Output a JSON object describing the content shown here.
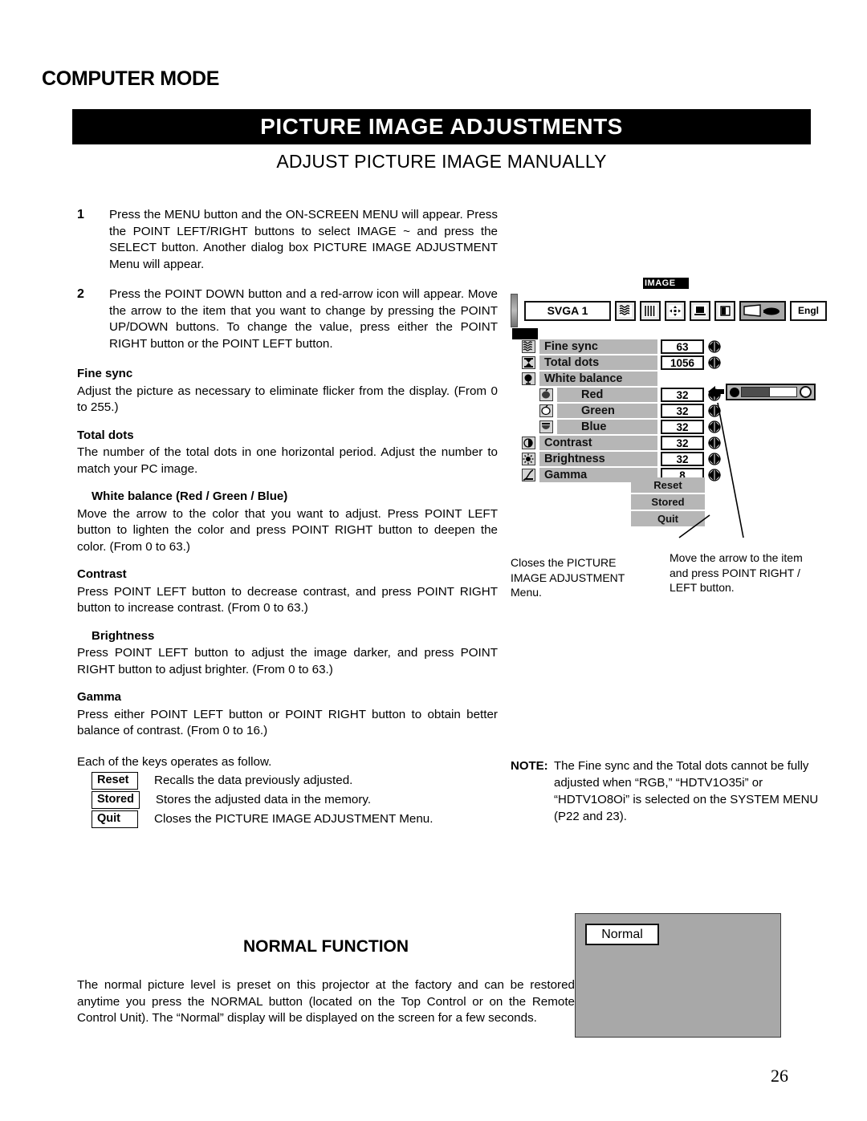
{
  "page": {
    "title": "COMPUTER MODE",
    "banner": "PICTURE IMAGE ADJUSTMENTS",
    "subbanner": "ADJUST PICTURE IMAGE MANUALLY",
    "number": "26"
  },
  "steps": [
    {
      "num": "1",
      "text": "Press the MENU button and the ON-SCREEN MENU will appear. Press the POINT LEFT/RIGHT buttons to select IMAGE ~ and press the SELECT button. Another dialog box PICTURE IMAGE ADJUSTMENT Menu will appear."
    },
    {
      "num": "2",
      "text": "Press the POINT DOWN button and a red-arrow icon will appear. Move the arrow to the item that you want to change by pressing the POINT UP/DOWN buttons. To change the value, press either the POINT RIGHT button or the POINT LEFT button."
    }
  ],
  "sections": [
    {
      "heading": "Fine sync",
      "body": "Adjust the picture as necessary to eliminate flicker from the display. (From 0 to 255.)"
    },
    {
      "heading": "Total dots",
      "body": "The number of the total dots in one horizontal period. Adjust the number to match your PC image."
    },
    {
      "heading": "White balance (Red / Green / Blue)",
      "body": "Move the arrow to the color that you want to adjust. Press POINT LEFT button to lighten the color and press POINT RIGHT button to deepen the color. (From 0 to 63.)"
    },
    {
      "heading": "Contrast",
      "body": "Press POINT LEFT button to decrease contrast, and press POINT RIGHT button to increase contrast. (From 0 to 63.)"
    },
    {
      "heading": "Brightness",
      "body": "Press POINT LEFT button to adjust the image darker, and press POINT RIGHT button to adjust brighter. (From 0 to 63.)"
    },
    {
      "heading": "Gamma",
      "body": "Press either POINT LEFT button or POINT RIGHT button to obtain better balance of contrast. (From 0 to 16.)"
    }
  ],
  "keys": {
    "intro": "Each of the keys operates as follow.",
    "rows": [
      {
        "key": "Reset",
        "desc": "Recalls the data previously adjusted."
      },
      {
        "key": "Stored",
        "desc": "Stores the adjusted data in the memory."
      },
      {
        "key": "Quit",
        "desc": "Closes the PICTURE IMAGE ADJUSTMENT Menu."
      }
    ]
  },
  "osd": {
    "source": "SVGA 1",
    "menu_tab": "IMAGE",
    "language": "Engl",
    "toolbar_icons": [
      "fine-sync-icon",
      "total-dots-icon",
      "position-icon",
      "screen-icon",
      "keystone-icon",
      "image-icon",
      "language-icon"
    ],
    "rows": [
      {
        "icon": "fine-sync-icon",
        "label": "Fine sync",
        "value": "63",
        "sub": false,
        "has_value": true
      },
      {
        "icon": "total-dots-icon",
        "label": "Total dots",
        "value": "1056",
        "sub": false,
        "has_value": true
      },
      {
        "icon": "white-balance-icon",
        "label": "White balance",
        "value": "",
        "sub": false,
        "has_value": false
      },
      {
        "icon": "red-icon",
        "label": "Red",
        "value": "32",
        "sub": true,
        "has_value": true
      },
      {
        "icon": "green-icon",
        "label": "Green",
        "value": "32",
        "sub": true,
        "has_value": true
      },
      {
        "icon": "blue-icon",
        "label": "Blue",
        "value": "32",
        "sub": true,
        "has_value": true
      },
      {
        "icon": "contrast-icon",
        "label": "Contrast",
        "value": "32",
        "sub": false,
        "has_value": true
      },
      {
        "icon": "brightness-icon",
        "label": "Brightness",
        "value": "32",
        "sub": false,
        "has_value": true
      },
      {
        "icon": "gamma-icon",
        "label": "Gamma",
        "value": "8",
        "sub": false,
        "has_value": true
      }
    ],
    "buttons": [
      "Reset",
      "Stored",
      "Quit"
    ]
  },
  "callouts": {
    "left": "Closes the PICTURE IMAGE ADJUSTMENT Menu.",
    "right": "Move the arrow to the item and press POINT RIGHT / LEFT button."
  },
  "note": {
    "label": "NOTE:",
    "body": "The Fine sync and the Total dots cannot be fully adjusted when “RGB,” “HDTV1O35i” or “HDTV1O8Oi” is selected on the SYSTEM MENU (P22 and 23)."
  },
  "normal_function": {
    "title": "NORMAL FUNCTION",
    "body": "The normal picture level is preset on this projector at the factory and can be restored anytime you press the NORMAL button (located on the Top Control or on the Remote Control Unit). The “Normal” display will be displayed on the screen for a few seconds.",
    "chip_label": "Normal"
  },
  "colors": {
    "banner_bg": "#000000",
    "osd_row_bg": "#b6b6b6",
    "osd_panel_bg": "#a8a8a8"
  }
}
